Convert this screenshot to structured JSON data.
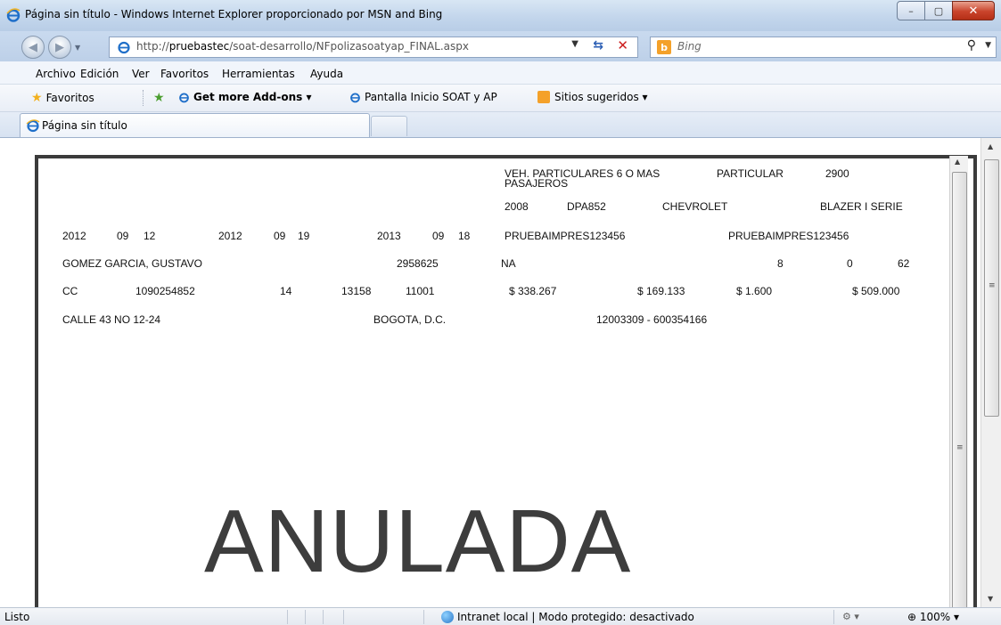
{
  "window": {
    "title": "Página sin título - Windows Internet Explorer proporcionado por MSN and Bing",
    "minimize_glyph": "–",
    "maximize_glyph": "▢",
    "close_glyph": "✕"
  },
  "address_bar": {
    "url_host": "http://",
    "url_bold": "pruebastec",
    "url_path": "/soat-desarrollo/NFpolizasoatyap_FINAL.aspx",
    "search_placeholder": "Bing"
  },
  "menu": [
    "Archivo",
    "Edición",
    "Ver",
    "Favoritos",
    "Herramientas",
    "Ayuda"
  ],
  "favorites_bar": {
    "favorites": "Favoritos",
    "addons": "Get more Add-ons ▾",
    "pantalla": "Pantalla Inicio SOAT y AP",
    "sitios": "Sitios sugeridos ▾"
  },
  "tab": {
    "title": "Página sin título"
  },
  "document": {
    "row1": {
      "vehicle_type": "VEH. PARTICULARES 6 O MAS",
      "vehicle_type_2": "PASAJEROS",
      "service": "PARTICULAR",
      "cc": "2900"
    },
    "row2": {
      "model": "2008",
      "plate": "DPA852",
      "brand": "CHEVROLET",
      "line": "BLAZER I SERIE"
    },
    "row3": {
      "start": [
        "2012",
        "09",
        "12"
      ],
      "issue": [
        "2012",
        "09",
        "19"
      ],
      "end": [
        "2013",
        "09",
        "18"
      ],
      "chassis": "PRUEBAIMPRES123456",
      "motor": "PRUEBAIMPRES123456"
    },
    "row4": {
      "name": "GOMEZ GARCIA, GUSTAVO",
      "phone": "2958625",
      "na": "NA",
      "v1": "8",
      "v2": "0",
      "v3": "62"
    },
    "row5": {
      "doc_type": "CC",
      "doc_number": "1090254852",
      "c1": "14",
      "c2": "13158",
      "c3": "11001",
      "prima": "$ 338.267",
      "contrib": "$ 169.133",
      "tasa": "$ 1.600",
      "total": "$ 509.000"
    },
    "row6": {
      "address": "CALLE 43 NO 12-24",
      "city": "BOGOTA, D.C.",
      "ref": "12003309 - 600354166"
    },
    "stamp": "ANULADA"
  },
  "status_bar": {
    "status": "Listo",
    "zone": "Intranet local | Modo protegido: desactivado",
    "zoom": "100%"
  }
}
